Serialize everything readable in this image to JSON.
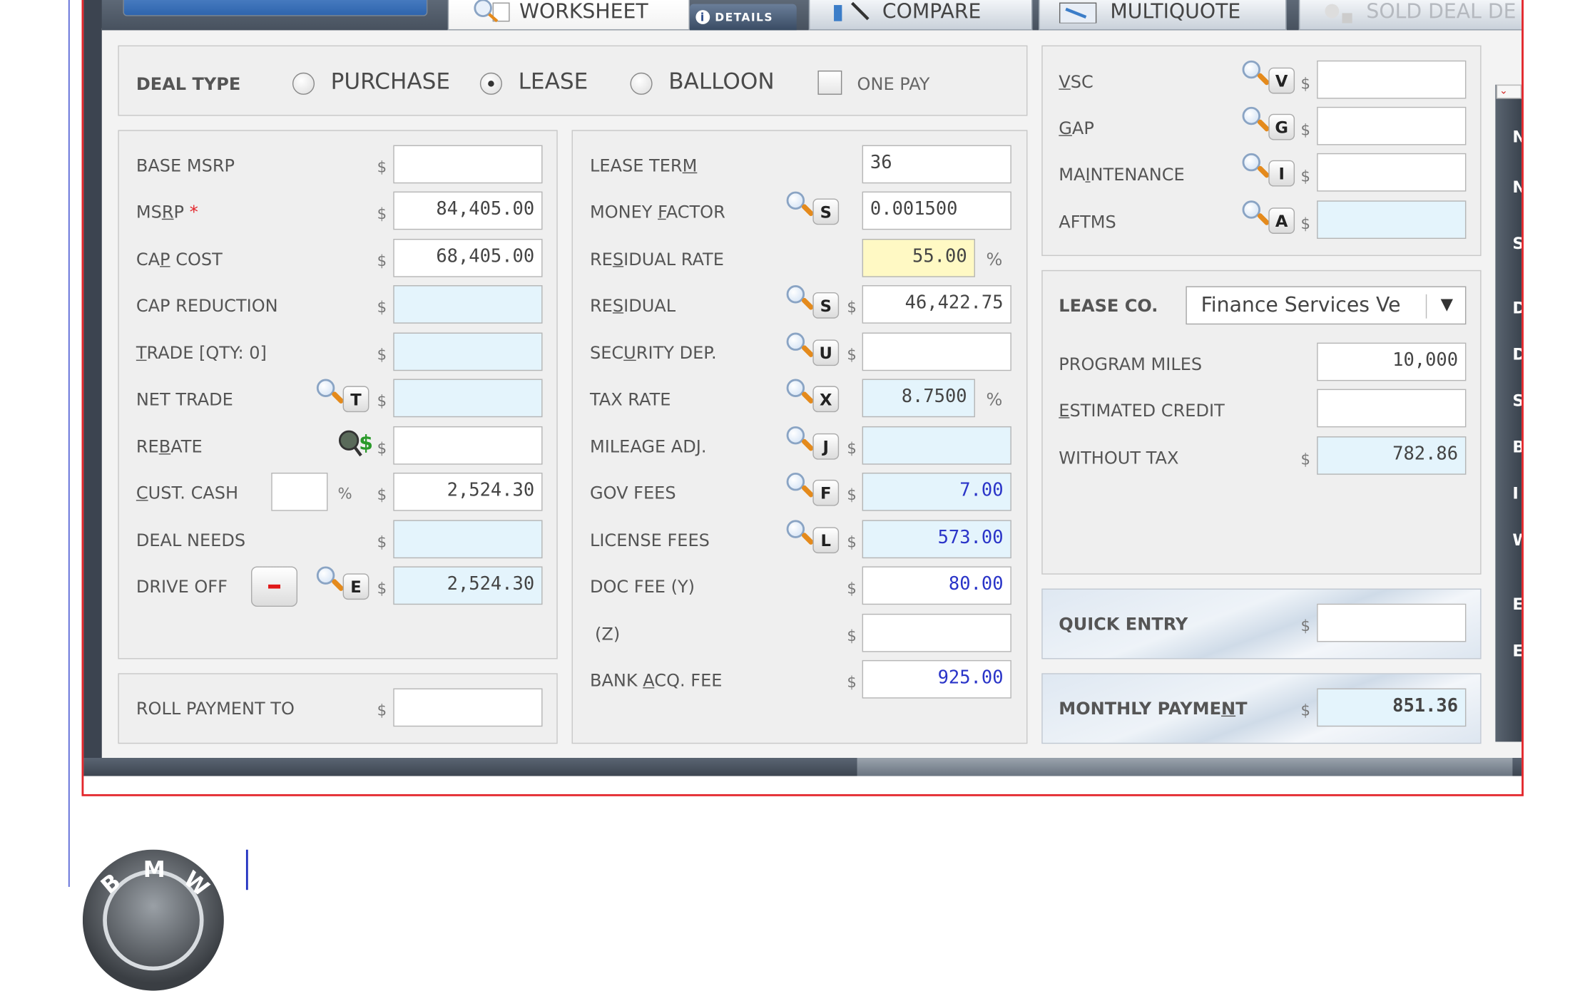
{
  "tabs": {
    "worksheet": "WORKSHEET",
    "details": "DETAILS",
    "compare": "COMPARE",
    "multiquote": "MULTIQUOTE",
    "sold_deal": "SOLD DEAL DE"
  },
  "deal_type": {
    "label": "DEAL TYPE",
    "options": [
      "PURCHASE",
      "LEASE",
      "BALLOON"
    ],
    "selected": "LEASE",
    "one_pay_label": "ONE PAY"
  },
  "left_panel": {
    "base_msrp": {
      "label": "BASE MSRP",
      "value": ""
    },
    "msrp": {
      "label_pre": "MS",
      "label_u": "R",
      "label_post": "P",
      "required_mark": "*",
      "value": "84,405.00"
    },
    "cap_cost": {
      "label_pre": "CA",
      "label_u": "P",
      "label_post": " COST",
      "value": "68,405.00"
    },
    "cap_reduction": {
      "label": "CAP REDUCTION",
      "value": ""
    },
    "trade": {
      "label_u": "T",
      "label_post": "RADE [QTY: 0]",
      "value": ""
    },
    "net_trade": {
      "label": "NET TRADE",
      "key": "T",
      "value": ""
    },
    "rebate": {
      "label_pre": "RE",
      "label_u": "B",
      "label_post": "ATE",
      "value": ""
    },
    "cust_cash": {
      "label_u": "C",
      "label_post": "UST. CASH",
      "pct_value": "",
      "value": "2,524.30"
    },
    "deal_needs": {
      "label": "DEAL NEEDS",
      "value": ""
    },
    "drive_off": {
      "label": "DRIVE OFF",
      "key": "E",
      "value": "2,524.30"
    },
    "roll_payment": {
      "label": "ROLL PAYMENT TO",
      "value": ""
    }
  },
  "middle_panel": {
    "lease_term": {
      "label_pre": "LEASE TER",
      "label_u": "M",
      "value": "36"
    },
    "money_factor": {
      "label_pre": "MONEY ",
      "label_u": "F",
      "label_post": "ACTOR",
      "key": "S",
      "value": "0.001500"
    },
    "residual_rate": {
      "label_pre": "RE",
      "label_u": "S",
      "label_post": "IDUAL RATE",
      "value": "55.00"
    },
    "residual": {
      "label_pre": "RE",
      "label_u": "S",
      "label_post": "IDUAL",
      "key": "S",
      "value": "46,422.75"
    },
    "security_dep": {
      "label_pre": "SEC",
      "label_u": "U",
      "label_post": "RITY DEP.",
      "key": "U",
      "value": ""
    },
    "tax_rate": {
      "label": "TAX RATE",
      "key": "X",
      "value": "8.7500"
    },
    "mileage_adj": {
      "label": "MILEAGE ADJ.",
      "key": "J",
      "value": ""
    },
    "gov_fees": {
      "label": "GOV FEES",
      "key": "F",
      "value": "7.00"
    },
    "license_fees": {
      "label": "LICENSE FEES",
      "key": "L",
      "value": "573.00"
    },
    "doc_fee": {
      "label": "DOC FEE (Y)",
      "value": "80.00"
    },
    "z_fee": {
      "label": "(Z)",
      "value": ""
    },
    "bank_acq_fee": {
      "label_pre": "BANK ",
      "label_u": "A",
      "label_post": "CQ. FEE",
      "value": "925.00"
    }
  },
  "right_panel": {
    "vsc": {
      "label_u": "V",
      "label_post": "SC",
      "key": "V",
      "value": ""
    },
    "gap": {
      "label_u": "G",
      "label_post": "AP",
      "key": "G",
      "value": ""
    },
    "maintenance": {
      "label_pre": "MA",
      "label_u": "I",
      "label_post": "NTENANCE",
      "key": "I",
      "value": ""
    },
    "aftms": {
      "label": "AFTMS",
      "key": "A",
      "value": ""
    },
    "lease_co": {
      "label": "LEASE CO.",
      "value": "Finance Services Ve"
    },
    "program_miles": {
      "label": "PROGRAM MILES",
      "value": "10,000"
    },
    "estimated_credit": {
      "label_u": "E",
      "label_post": "STIMATED CREDIT",
      "value": ""
    },
    "without_tax": {
      "label": "WITHOUT TAX",
      "value": "782.86"
    },
    "quick_entry": {
      "label": "QUICK ENTRY",
      "value": ""
    },
    "monthly_payment": {
      "label_pre": "MONTHLY PAYME",
      "label_u": "N",
      "label_post": "T",
      "value": "851.36"
    }
  },
  "side_strip_letters": [
    "N",
    "N",
    "S",
    "D",
    "D",
    "S",
    "B",
    "I",
    "W",
    "E",
    "E"
  ],
  "currency_symbol": "$",
  "percent_symbol": "%",
  "colors": {
    "accent_red": "#e3262b",
    "input_blue": "#e4f4fc",
    "input_yellow": "#fff9c4",
    "value_blue": "#2a34c8"
  }
}
